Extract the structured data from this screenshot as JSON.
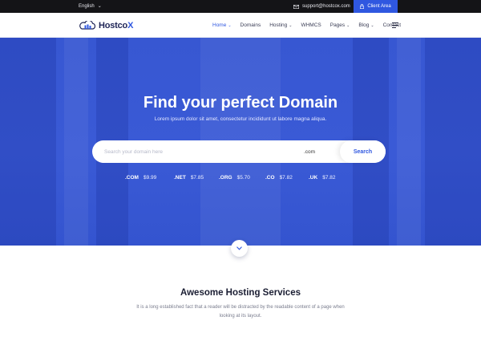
{
  "topbar": {
    "language": "English",
    "email": "support@hostcox.com",
    "client_area": "Client Area"
  },
  "brand": {
    "name_main": "Hostco",
    "name_accent": "X"
  },
  "nav": {
    "items": [
      {
        "label": "Home",
        "active": true,
        "dropdown": true
      },
      {
        "label": "Domains",
        "active": false,
        "dropdown": false
      },
      {
        "label": "Hosting",
        "active": false,
        "dropdown": true
      },
      {
        "label": "WHMCS",
        "active": false,
        "dropdown": false
      },
      {
        "label": "Pages",
        "active": false,
        "dropdown": true
      },
      {
        "label": "Blog",
        "active": false,
        "dropdown": true
      },
      {
        "label": "Contact",
        "active": false,
        "dropdown": false
      }
    ]
  },
  "hero": {
    "title": "Find your perfect Domain",
    "subtitle": "Lorem ipsum dolor sit amet, consectetur incididunt ut labore magna aliqua.",
    "search_placeholder": "Search your domain here",
    "tld_selected": ".com",
    "search_button": "Search",
    "prices": [
      {
        "tld": ".COM",
        "price": "$9.99"
      },
      {
        "tld": ".NET",
        "price": "$7.85"
      },
      {
        "tld": ".ORG",
        "price": "$5.70"
      },
      {
        "tld": ".CO",
        "price": "$7.82"
      },
      {
        "tld": ".UK",
        "price": "$7.82"
      }
    ]
  },
  "section": {
    "title": "Awesome Hosting Services",
    "description": "It is a long established fact that a reader will be distracted by the readable content of a page when looking at its layout."
  },
  "colors": {
    "accent": "#2f57e0",
    "topbar_bg": "#141417",
    "hero_bg": "#3a5ad6"
  }
}
